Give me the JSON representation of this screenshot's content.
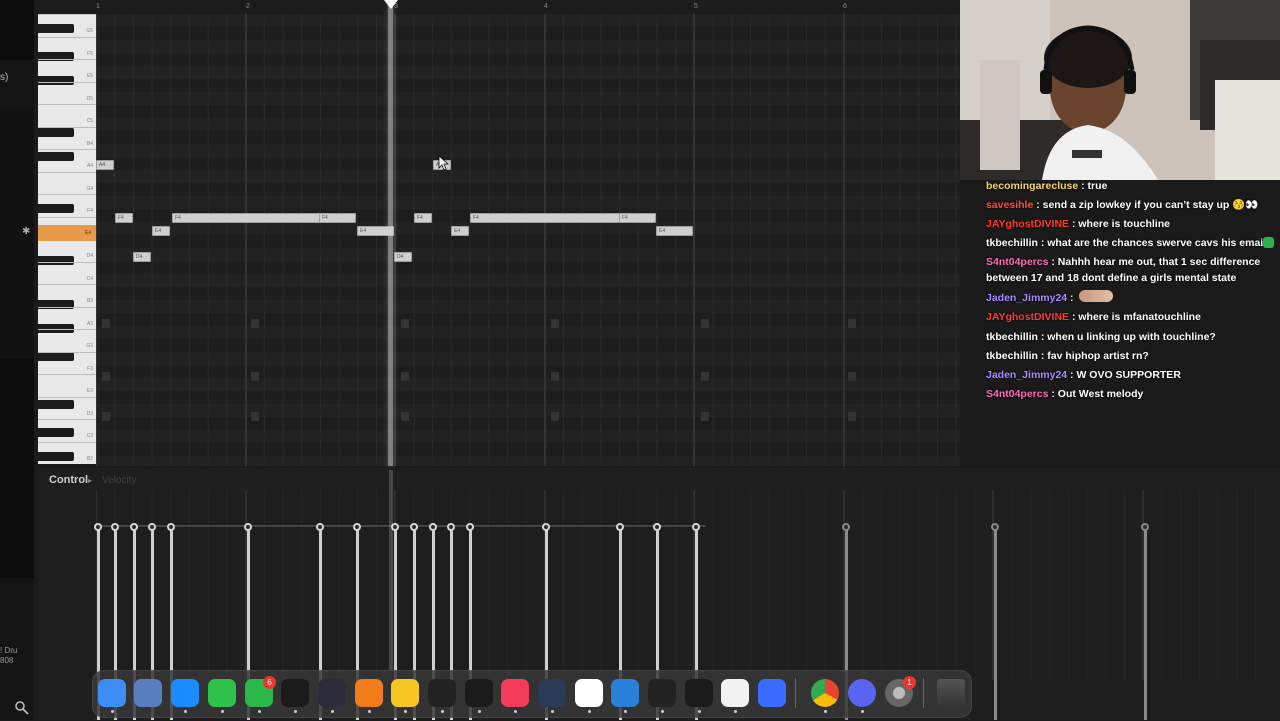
{
  "ruler": {
    "bars": [
      "2",
      "3",
      "4",
      "5",
      "6"
    ]
  },
  "leftbar": {
    "paren": "s)",
    "label": "! Dru\n808"
  },
  "piano": {
    "labels": [
      "G5",
      "F5",
      "E5",
      "D5",
      "C5",
      "B4",
      "A4",
      "G4",
      "F4",
      "E4",
      "D4",
      "C4",
      "B3",
      "A3",
      "G3",
      "F3",
      "E3",
      "D3",
      "C3",
      "B2"
    ],
    "highlight_label": "E4"
  },
  "notes": [
    {
      "label": "A4"
    },
    {
      "label": "F4"
    },
    {
      "label": "E4"
    },
    {
      "label": "D4"
    },
    {
      "label": "F4"
    },
    {
      "label": "F4"
    },
    {
      "label": "E4"
    },
    {
      "label": "A4"
    },
    {
      "label": "F4"
    },
    {
      "label": "E4"
    },
    {
      "label": "D4"
    },
    {
      "label": "F4"
    },
    {
      "label": "F4"
    },
    {
      "label": "E4"
    }
  ],
  "control": {
    "label": "Control",
    "sub": "Velocity"
  },
  "chat": {
    "messages": [
      {
        "user": "becomingarecluse",
        "color": "#f3d56b",
        "text": " : true"
      },
      {
        "user": "savesihle",
        "color": "#ff4d3d",
        "text": " : send a zip lowkey if you can’t stay up 😚👀"
      },
      {
        "user": "JAYghostDIVINE",
        "color": "#ff3b30",
        "text": " : where is touchline"
      },
      {
        "user": "tkbechillin",
        "color": "#ffffff",
        "text": " : what are the chances swerve cavs his emails"
      },
      {
        "user": "S4nt04percs",
        "color": "#ff6bb3",
        "text": " : Nahhh hear me out, that 1 sec difference between 17 and 18 dont define a girls mental state"
      },
      {
        "user": "Jaden_Jimmy24",
        "color": "#a98bff",
        "text": " :"
      },
      {
        "user": "JAYghostDIVINE",
        "color": "#ff3b30",
        "text": " : where is mfanatouchline"
      },
      {
        "user": "tkbechillin",
        "color": "#ffffff",
        "text": " : when u linking up with touchline?"
      },
      {
        "user": "tkbechillin",
        "color": "#ffffff",
        "text": " : fav hiphop artist rn?"
      },
      {
        "user": "Jaden_Jimmy24",
        "color": "#a98bff",
        "text": " : W OVO SUPPORTER"
      },
      {
        "user": "S4nt04percs",
        "color": "#ff6bb3",
        "text": " : Out West melody"
      }
    ]
  },
  "dock": {
    "badges": {
      "facetime": "6",
      "system_settings": "1"
    },
    "apps": [
      "finder",
      "files",
      "safari",
      "messages",
      "facetime",
      "kontakt",
      "obs",
      "fl-studio",
      "notes",
      "capcut",
      "tradingview",
      "music",
      "davinci",
      "github",
      "vscode",
      "chatgpt",
      "capcut-alt",
      "notion",
      "roblox",
      "chrome",
      "discord",
      "system-settings",
      "trash"
    ]
  },
  "colors": {
    "accent_key": "#e79a4a",
    "note_fill": "#cfcfcf",
    "roll_bg": "#212121"
  }
}
